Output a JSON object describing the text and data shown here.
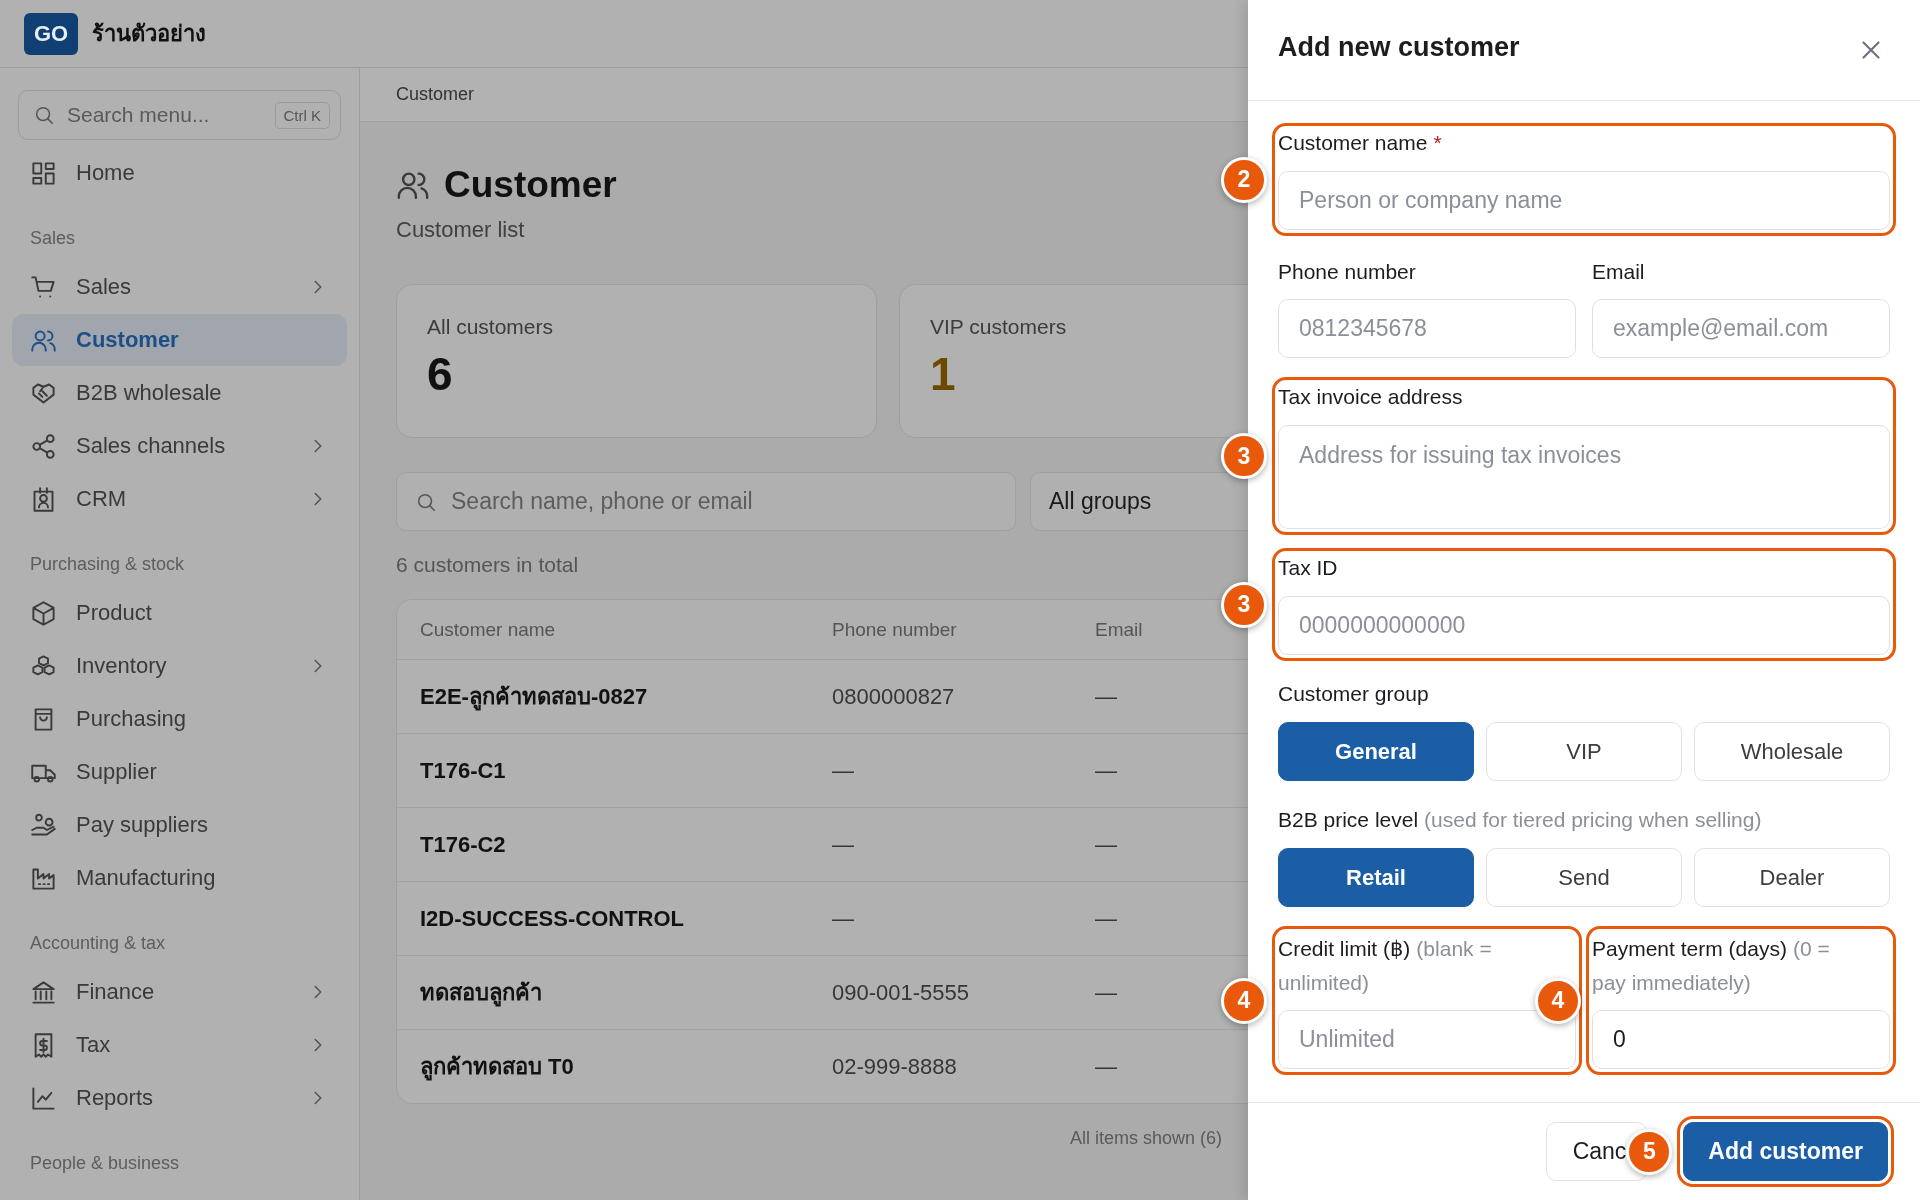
{
  "app": {
    "logo": "GO",
    "shop_name": "ร้านตัวอย่าง"
  },
  "sidebar": {
    "search": {
      "placeholder": "Search menu...",
      "shortcut": "Ctrl K"
    },
    "sections": [
      {
        "items": [
          {
            "label": "Home",
            "selected": false,
            "has_submenu": false
          }
        ]
      },
      {
        "heading": "Sales",
        "items": [
          {
            "label": "Sales",
            "selected": false,
            "has_submenu": true
          },
          {
            "label": "Customer",
            "selected": true,
            "has_submenu": false
          },
          {
            "label": "B2B wholesale",
            "selected": false,
            "has_submenu": false
          },
          {
            "label": "Sales channels",
            "selected": false,
            "has_submenu": true
          },
          {
            "label": "CRM",
            "selected": false,
            "has_submenu": true
          }
        ]
      },
      {
        "heading": "Purchasing & stock",
        "items": [
          {
            "label": "Product",
            "selected": false,
            "has_submenu": false
          },
          {
            "label": "Inventory",
            "selected": false,
            "has_submenu": true
          },
          {
            "label": "Purchasing",
            "selected": false,
            "has_submenu": false
          },
          {
            "label": "Supplier",
            "selected": false,
            "has_submenu": false
          },
          {
            "label": "Pay suppliers",
            "selected": false,
            "has_submenu": false
          },
          {
            "label": "Manufacturing",
            "selected": false,
            "has_submenu": false
          }
        ]
      },
      {
        "heading": "Accounting & tax",
        "items": [
          {
            "label": "Finance",
            "selected": false,
            "has_submenu": true
          },
          {
            "label": "Tax",
            "selected": false,
            "has_submenu": true
          },
          {
            "label": "Reports",
            "selected": false,
            "has_submenu": true
          }
        ]
      },
      {
        "heading": "People & business"
      }
    ]
  },
  "breadcrumb": "Customer",
  "page": {
    "title": "Customer",
    "subtitle": "Customer list"
  },
  "stats": [
    {
      "label": "All customers",
      "value": "6",
      "kind": "plain"
    },
    {
      "label": "VIP customers",
      "value": "1",
      "kind": "vip"
    }
  ],
  "search": {
    "placeholder": "Search name, phone or email"
  },
  "group_filter": {
    "value": "All groups"
  },
  "total": "6 customers in total",
  "table": {
    "columns": [
      "Customer name",
      "Phone number",
      "Email"
    ],
    "rows": [
      [
        "E2E-ลูกค้าทดสอบ-0827",
        "0800000827",
        "—"
      ],
      [
        "T176-C1",
        "—",
        "—"
      ],
      [
        "T176-C2",
        "—",
        "—"
      ],
      [
        "I2D-SUCCESS-CONTROL",
        "—",
        "—"
      ],
      [
        "ทดสอบลูกค้า",
        "090-001-5555",
        "—"
      ],
      [
        "ลูกค้าทดสอบ T0",
        "02-999-8888",
        "—"
      ]
    ]
  },
  "table_footer": "All items shown (6)",
  "drawer": {
    "title": "Add new customer",
    "rows": [
      [
        {
          "kind": "input",
          "label": "Customer name",
          "required_mark": "*",
          "placeholder": "Person or company name",
          "highlighted": true,
          "badge": "2"
        }
      ],
      [
        {
          "kind": "input",
          "label": "Phone number",
          "placeholder": "0812345678",
          "highlighted": false
        },
        {
          "kind": "input",
          "label": "Email",
          "placeholder": "example@email.com",
          "highlighted": false
        }
      ],
      [
        {
          "kind": "textarea",
          "label": "Tax invoice address",
          "placeholder": "Address for issuing tax invoices",
          "highlighted": true,
          "badge": "3"
        }
      ],
      [
        {
          "kind": "input",
          "label": "Tax ID",
          "placeholder": "0000000000000",
          "highlighted": true,
          "badge": "3"
        }
      ],
      [
        {
          "kind": "choice",
          "label": "Customer group",
          "highlighted": false,
          "options": [
            {
              "label": "General",
              "selected": true
            },
            {
              "label": "VIP",
              "selected": false
            },
            {
              "label": "Wholesale",
              "selected": false
            }
          ]
        }
      ],
      [
        {
          "kind": "choice",
          "label": "B2B price level",
          "hint": "(used for tiered pricing when selling)",
          "highlighted": false,
          "options": [
            {
              "label": "Retail",
              "selected": true
            },
            {
              "label": "Send",
              "selected": false
            },
            {
              "label": "Dealer",
              "selected": false
            }
          ]
        }
      ],
      [
        {
          "kind": "input",
          "label": "Credit limit (฿)",
          "hint": "(blank = unlimited)",
          "placeholder": "Unlimited",
          "highlighted": true,
          "badge": "4"
        },
        {
          "kind": "input",
          "label": "Payment term (days)",
          "hint": "(0 = pay immediately)",
          "value": "0",
          "highlighted": true,
          "badge": "4"
        }
      ]
    ],
    "buttons": [
      {
        "label": "Canc",
        "kind": "secondary",
        "highlighted": false
      },
      {
        "label": "Add customer",
        "kind": "primary",
        "highlighted": true,
        "badge": "5"
      }
    ]
  }
}
